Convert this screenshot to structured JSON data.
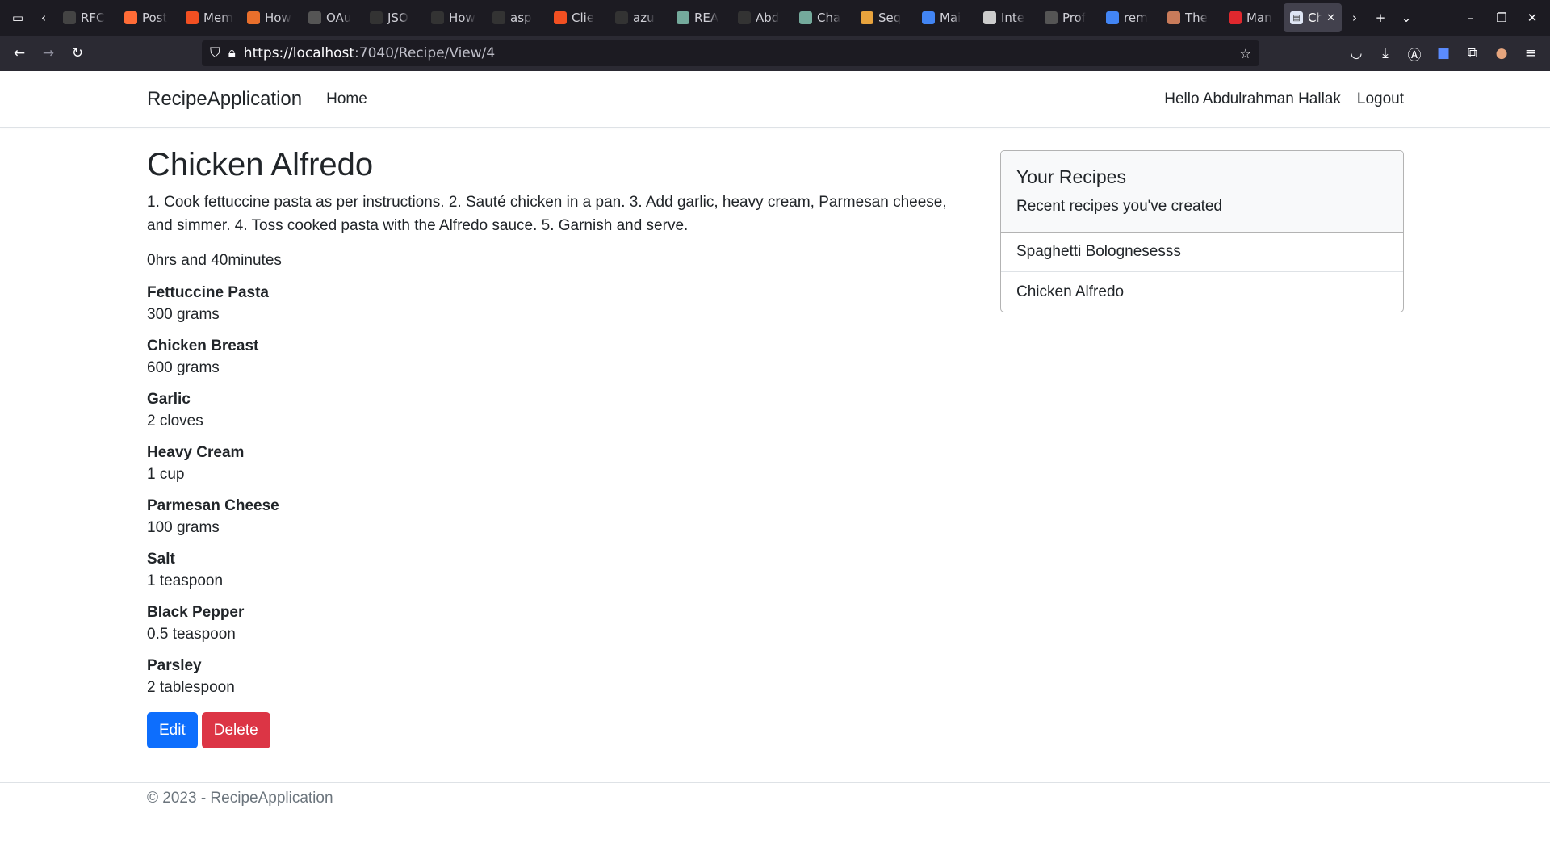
{
  "browser": {
    "tabs": [
      {
        "title": "RFC",
        "icon": "rfc-icon",
        "color": "#444"
      },
      {
        "title": "Post",
        "icon": "postman-icon",
        "color": "#ff6c37"
      },
      {
        "title": "Mem",
        "icon": "microsoft-icon",
        "color": "#f25022"
      },
      {
        "title": "How",
        "icon": "doc-icon",
        "color": "#e86f2c"
      },
      {
        "title": "OAu",
        "icon": "oauth-icon",
        "color": "#555"
      },
      {
        "title": "JSO",
        "icon": "shield-icon",
        "color": "#333"
      },
      {
        "title": "How",
        "icon": "shield-icon",
        "color": "#333"
      },
      {
        "title": "asp",
        "icon": "github-icon",
        "color": "#333"
      },
      {
        "title": "Clie",
        "icon": "microsoft-icon",
        "color": "#f25022"
      },
      {
        "title": "azu",
        "icon": "github-icon",
        "color": "#333"
      },
      {
        "title": "REA",
        "icon": "chatgpt-icon",
        "color": "#74aa9c"
      },
      {
        "title": "Abd",
        "icon": "github-icon",
        "color": "#333"
      },
      {
        "title": "Cha",
        "icon": "chatgpt-icon",
        "color": "#74aa9c"
      },
      {
        "title": "Seq",
        "icon": "seq-icon",
        "color": "#e8a33d"
      },
      {
        "title": "Mai",
        "icon": "google-icon",
        "color": "#4285f4"
      },
      {
        "title": "Inte",
        "icon": "doc-icon",
        "color": "#ccc"
      },
      {
        "title": "Prof",
        "icon": "info-icon",
        "color": "#555"
      },
      {
        "title": "rem",
        "icon": "google-icon",
        "color": "#4285f4"
      },
      {
        "title": "The",
        "icon": "avatar-icon",
        "color": "#c97b5a"
      },
      {
        "title": "Man",
        "icon": "target-icon",
        "color": "#e0282e"
      }
    ],
    "active_tab": {
      "title": "Ch",
      "icon": "doc-icon"
    },
    "url_host": "https://localhost",
    "url_rest": ":7040/Recipe/View/4"
  },
  "header": {
    "brand": "RecipeApplication",
    "nav_home": "Home",
    "greeting": "Hello Abdulrahman Hallak",
    "logout": "Logout"
  },
  "recipe": {
    "title": "Chicken Alfredo",
    "instructions": "1. Cook fettuccine pasta as per instructions. 2. Sauté chicken in a pan. 3. Add garlic, heavy cream, Parmesan cheese, and simmer. 4. Toss cooked pasta with the Alfredo sauce. 5. Garnish and serve.",
    "duration": "0hrs and 40minutes",
    "ingredients": [
      {
        "name": "Fettuccine Pasta",
        "qty": "300 grams"
      },
      {
        "name": "Chicken Breast",
        "qty": "600 grams"
      },
      {
        "name": "Garlic",
        "qty": "2 cloves"
      },
      {
        "name": "Heavy Cream",
        "qty": "1 cup"
      },
      {
        "name": "Parmesan Cheese",
        "qty": "100 grams"
      },
      {
        "name": "Salt",
        "qty": "1 teaspoon"
      },
      {
        "name": "Black Pepper",
        "qty": "0.5 teaspoon"
      },
      {
        "name": "Parsley",
        "qty": "2 tablespoon"
      }
    ],
    "edit_label": "Edit",
    "delete_label": "Delete"
  },
  "sidebar": {
    "title": "Your Recipes",
    "subtitle": "Recent recipes you've created",
    "recipes": [
      "Spaghetti Bolognesesss",
      "Chicken Alfredo"
    ]
  },
  "footer": {
    "text": "© 2023 - RecipeApplication"
  },
  "colors": {
    "primary": "#0d6efd",
    "danger": "#dc3545",
    "muted": "#6c757d"
  }
}
